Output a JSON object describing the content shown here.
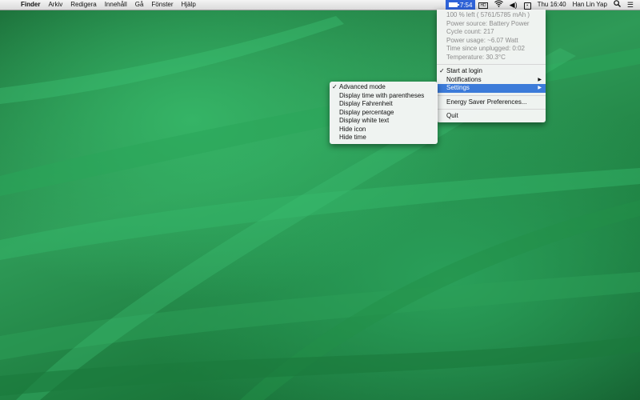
{
  "menubar": {
    "apple_icon": "",
    "app_name": "Finder",
    "items": [
      "Arkiv",
      "Redigera",
      "Innehåll",
      "Gå",
      "Fönster",
      "Hjälp"
    ],
    "battery_time": "7:54",
    "battery_level": 1.0,
    "clock": "Thu 16:40",
    "user": "Han Lin Yap",
    "status_icons": [
      "control-center-icon",
      "wifi-icon",
      "volume-icon",
      "input-source-icon",
      "spotlight-icon",
      "notification-center-icon"
    ]
  },
  "battery_menu": {
    "info": [
      "100 % left ( 5761/5785 mAh )",
      "Power source: Battery Power",
      "Cycle count: 217",
      "Power usage: ~6.07 Watt",
      "Time since unplugged: 0:02",
      "Temperature: 30.3°C"
    ],
    "start_at_login": "Start at login",
    "notifications": "Notifications",
    "settings": "Settings",
    "energy_saver": "Energy Saver Preferences...",
    "quit": "Quit"
  },
  "settings_menu": {
    "items": [
      {
        "label": "Advanced mode",
        "checked": true
      },
      {
        "label": "Display time with parentheses",
        "checked": false
      },
      {
        "label": "Display Fahrenheit",
        "checked": false
      },
      {
        "label": "Display percentage",
        "checked": false
      },
      {
        "label": "Display white text",
        "checked": false
      },
      {
        "label": "Hide icon",
        "checked": false
      },
      {
        "label": "Hide time",
        "checked": false
      }
    ]
  },
  "colors": {
    "highlight": "#3c7bd9",
    "battery_item_bg": "#2f63d8",
    "wallpaper_green": "#1f7d3e"
  }
}
